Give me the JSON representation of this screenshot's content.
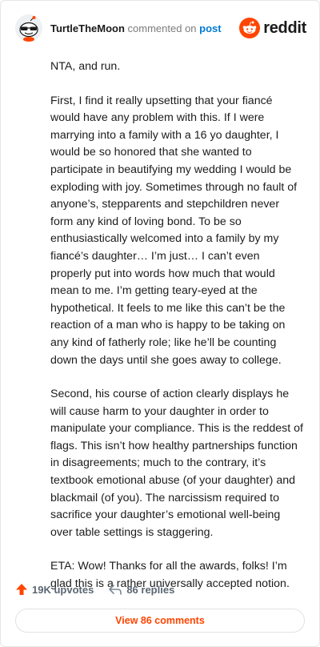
{
  "header": {
    "username": "TurtleTheMoon",
    "commented_text": "commented on",
    "post_link": "post",
    "brand": "reddit",
    "brand_color": "#ff4500"
  },
  "comment": {
    "paragraphs": [
      "NTA, and run.",
      "First, I find it really upsetting that your fiancé would have any problem with this. If I were marrying into a family with a 16 yo daughter, I would be so honored that she wanted to participate in beautifying my wedding I would be exploding with joy. Sometimes through no fault of anyone’s, stepparents and stepchildren never form any kind of loving bond. To be so enthusiastically welcomed into a family by my fiancé’s daughter… I’m just… I can’t even properly put into words how much that would mean to me. I’m getting teary-eyed at the hypothetical. It feels to me like this can’t be the reaction of a man who is happy to be taking on any kind of fatherly role; like he’ll be counting down the days until she goes away to college.",
      "Second, his course of action clearly displays he will cause harm to your daughter in order to manipulate your compliance. This is the reddest of flags. This isn’t how healthy partnerships function in disagreements; much to the contrary, it’s textbook emotional abuse (of your daughter) and blackmail (of you). The narcissism required to sacrifice your daughter’s emotional well-being over table settings is staggering.",
      "ETA: Wow! Thanks for all the awards, folks! I’m glad this is a rather universally accepted notion."
    ]
  },
  "actions": {
    "upvotes": "19K upvotes",
    "replies": "86 replies",
    "upvote_icon": "upvote-arrow-icon",
    "reply_icon": "reply-arrow-icon",
    "upvote_color": "#ff4500"
  },
  "view_comments_button": "View 86 comments"
}
